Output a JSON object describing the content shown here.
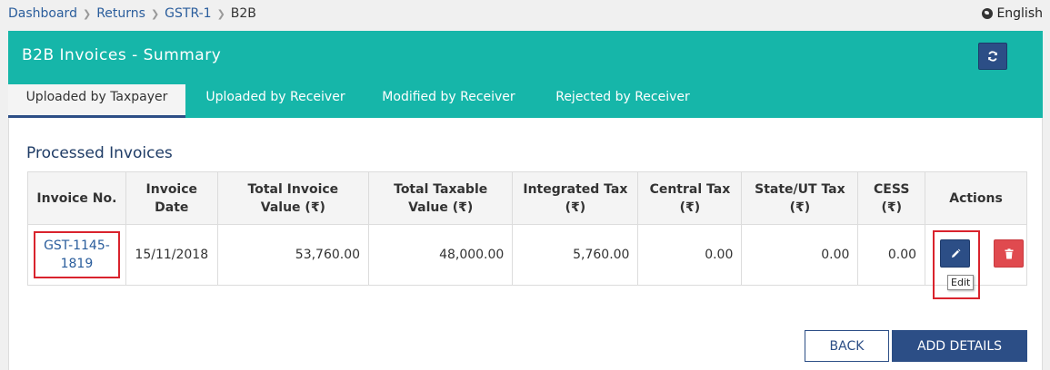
{
  "breadcrumb": {
    "items": [
      "Dashboard",
      "Returns",
      "GSTR-1"
    ],
    "current": "B2B"
  },
  "language": "English",
  "header": {
    "title": "B2B Invoices - Summary"
  },
  "tabs": [
    {
      "label": "Uploaded by Taxpayer",
      "active": true
    },
    {
      "label": "Uploaded by Receiver",
      "active": false
    },
    {
      "label": "Modified by Receiver",
      "active": false
    },
    {
      "label": "Rejected by Receiver",
      "active": false
    }
  ],
  "section_title": "Processed Invoices",
  "table": {
    "columns": [
      "Invoice No.",
      "Invoice Date",
      "Total Invoice Value (₹)",
      "Total Taxable Value (₹)",
      "Integrated Tax (₹)",
      "Central Tax (₹)",
      "State/UT Tax (₹)",
      "CESS (₹)",
      "Actions"
    ],
    "col_lines": [
      [
        "Invoice No."
      ],
      [
        "Invoice",
        "Date"
      ],
      [
        "Total Invoice",
        "Value (₹)"
      ],
      [
        "Total Taxable",
        "Value (₹)"
      ],
      [
        "Integrated Tax",
        "(₹)"
      ],
      [
        "Central Tax",
        "(₹)"
      ],
      [
        "State/UT Tax",
        "(₹)"
      ],
      [
        "CESS",
        "(₹)"
      ],
      [
        "Actions"
      ]
    ],
    "rows": [
      {
        "invoice_no_lines": [
          "GST-1145-",
          "1819"
        ],
        "invoice_date": "15/11/2018",
        "total_invoice_value": "53,760.00",
        "total_taxable_value": "48,000.00",
        "integrated_tax": "5,760.00",
        "central_tax": "0.00",
        "state_ut_tax": "0.00",
        "cess": "0.00"
      }
    ]
  },
  "tooltip": "Edit",
  "buttons": {
    "back": "BACK",
    "add_details": "ADD DETAILS"
  },
  "icons": {
    "refresh": "refresh-icon",
    "edit": "pencil-icon",
    "delete": "trash-icon",
    "language": "globe-icon"
  },
  "colors": {
    "header_teal": "#16b6a9",
    "primary_navy": "#2c4e86",
    "danger_red": "#e04a4f",
    "highlight_red": "#d9232d",
    "link_blue": "#2a5d9c"
  }
}
